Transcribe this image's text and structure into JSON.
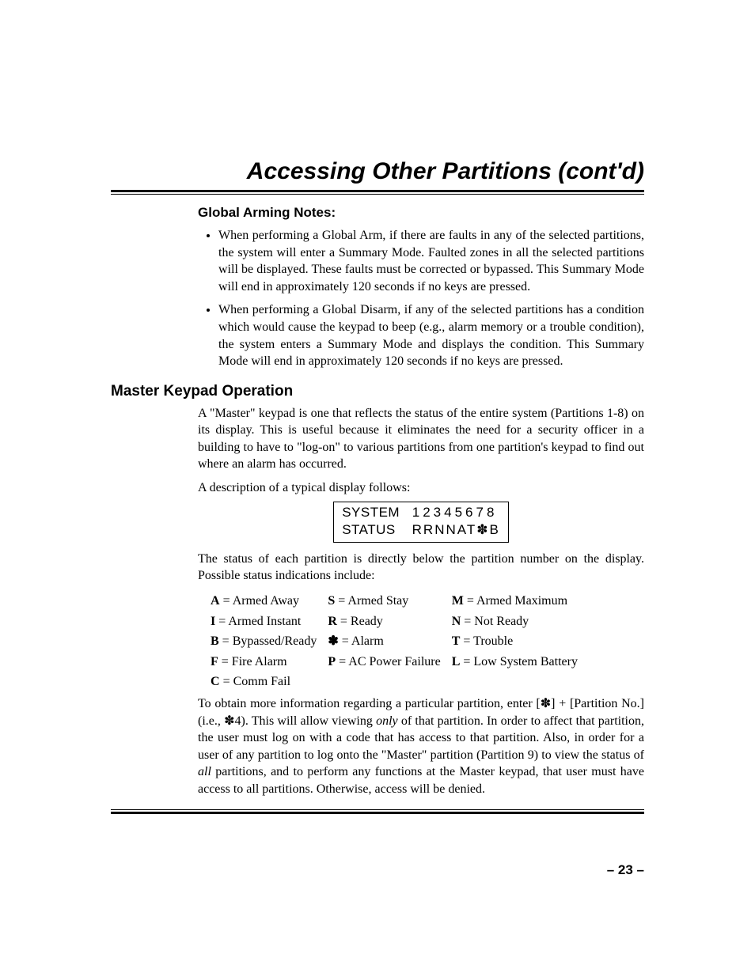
{
  "title": "Accessing Other Partitions (cont'd)",
  "globalArming": {
    "heading": "Global Arming Notes:",
    "bullets": [
      "When performing a Global Arm, if there are faults in any of the selected partitions, the system will enter a Summary Mode. Faulted zones in all the selected partitions will be displayed. These faults must be corrected or bypassed. This Summary Mode will end in approximately 120 seconds if no keys are pressed.",
      "When performing a Global Disarm, if any of the selected partitions has a condition which would cause the keypad to beep (e.g., alarm memory or a trouble condition), the system enters a Summary Mode and displays the condition. This Summary Mode will end in approximately 120 seconds if no keys are pressed."
    ]
  },
  "masterKeypad": {
    "heading": "Master Keypad Operation",
    "intro1": "A \"Master\" keypad is one that reflects the status of the entire system (Partitions 1-8) on its display.  This is useful because it eliminates the need for a security officer in a building to have to \"log-on\" to various partitions from one partition's keypad to find out where an alarm has occurred.",
    "intro2": "A description of a typical display follows:",
    "lcd": {
      "label1": "SYSTEM",
      "nums": "12345678",
      "label2": "STATUS",
      "stat": "RRNNAT✽B"
    },
    "afterLcd": "The status of each partition is directly below the partition number on the display. Possible status indications include:",
    "codes": [
      [
        "A",
        "Armed Away",
        "S",
        "Armed Stay",
        "M",
        "Armed Maximum"
      ],
      [
        "I",
        "Armed Instant",
        "R",
        "Ready",
        "N",
        "Not Ready"
      ],
      [
        "B",
        "Bypassed/Ready",
        "✽",
        "Alarm",
        "T",
        "Trouble"
      ],
      [
        "F",
        "Fire Alarm",
        "P",
        "AC Power Failure",
        "L",
        "Low System Battery"
      ],
      [
        "C",
        "Comm Fail",
        "",
        "",
        "",
        ""
      ]
    ],
    "final_pre": "To obtain more information regarding a particular partition, enter [✽] + [Partition No.] (i.e., ✽4).  This will allow viewing ",
    "final_only": "only",
    "final_mid": " of that partition.  In order to affect that partition, the user must log on with a code that has access to that partition.  Also, in order for a user of any partition to log onto the \"Master\" partition (Partition 9) to view the status of ",
    "final_all": "all",
    "final_post": " partitions, and to perform any functions at the Master keypad, that user must have access to all partitions.  Otherwise, access will be denied."
  },
  "pageNumber": "– 23 –"
}
